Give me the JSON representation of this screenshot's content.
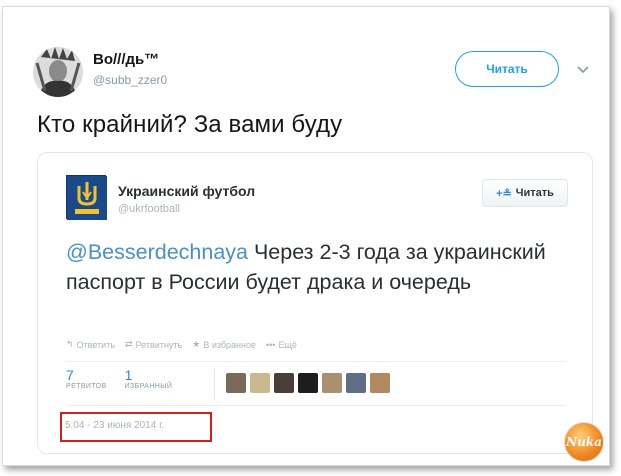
{
  "tweet": {
    "author_name": "Во///дь™",
    "author_handle": "@subb_zzer0",
    "follow_label": "Читать",
    "text": "Кто крайний? За вами буду"
  },
  "embedded_tweet": {
    "author_name": "Украинский футбол",
    "author_handle": "@ukrfootball",
    "follow_plus": "+≗",
    "follow_label": "Читать",
    "mention": "@Besserdechnaya",
    "text": " Через 2-3 года за украинский паспорт в России будет драка и очередь",
    "actions": [
      {
        "icon": "reply-icon",
        "glyph": "↰",
        "label": "Ответить"
      },
      {
        "icon": "retweet-icon",
        "glyph": "⇄",
        "label": "Ретвитнуть"
      },
      {
        "icon": "favorite-icon",
        "glyph": "★",
        "label": "В избранное"
      },
      {
        "icon": "more-icon",
        "glyph": "•••",
        "label": "Ещё"
      }
    ],
    "stats": {
      "retweets_count": "7",
      "retweets_label": "РЕТВИТОВ",
      "favorites_count": "1",
      "favorites_label": "ИЗБРАННЫЙ"
    },
    "timestamp": "5:04 - 23 июня 2014 г."
  },
  "watermark_text": "Nuka",
  "colors": {
    "twitter_blue": "#1da1f2",
    "highlight_red": "#d02020",
    "mention_blue": "#4a90c8"
  }
}
